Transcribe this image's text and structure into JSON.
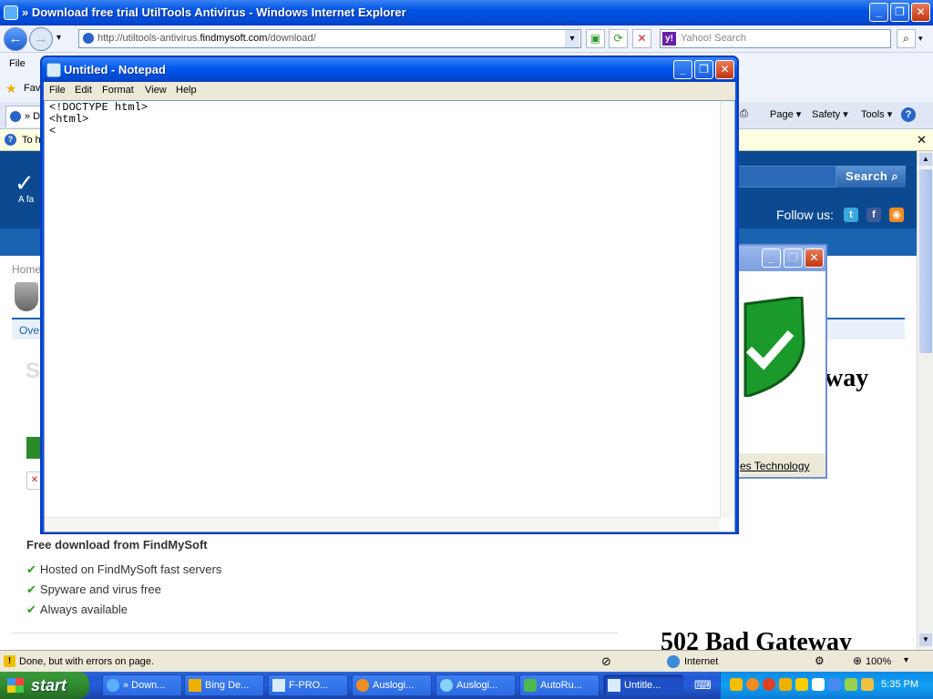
{
  "browser": {
    "title": "» Download free trial UtilTools Antivirus - Windows Internet Explorer",
    "address_prefix": "http://utiltools-antivirus.",
    "address_domain": "findmysoft.com",
    "address_suffix": "/download/",
    "search_placeholder": "Yahoo! Search",
    "menu": {
      "file": "File"
    },
    "favorites_label": "Fav",
    "tab_label": "» D",
    "infobar_text": "To h",
    "commands": {
      "page": "Page ▾",
      "safety": "Safety ▾",
      "tools": "Tools ▾"
    }
  },
  "page": {
    "tagline": "A fa",
    "search_button": "Search",
    "follow_us": "Follow us:",
    "breadcrumb": "Home",
    "tab_overview": "Ove",
    "download_title": "Free download from FindMySoft",
    "features": [
      "Hosted on FindMySoft fast servers",
      "Spyware and virus free",
      "Always available"
    ],
    "error_text_1": "way",
    "error_text_2": "502 Bad Gateway"
  },
  "dialog": {
    "link": "es Technology"
  },
  "notepad": {
    "title": "Untitled - Notepad",
    "menu": [
      "File",
      "Edit",
      "Format",
      "View",
      "Help"
    ],
    "content": "<!DOCTYPE html>\n<html>\n<"
  },
  "statusbar": {
    "text": "Done, but with errors on page.",
    "zone": "Internet",
    "zoom": "100%"
  },
  "taskbar": {
    "start": "start",
    "items": [
      "» Down...",
      "Bing De...",
      "F-PRO...",
      "Auslogi...",
      "Auslogi...",
      "AutoRu...",
      "Untitle..."
    ],
    "clock": "5:35 PM"
  },
  "colors": {
    "xp_blue": "#0054e3",
    "site_header": "#0b4a91",
    "start_green": "#2f8a2f",
    "check_green": "#2a9a2a"
  }
}
